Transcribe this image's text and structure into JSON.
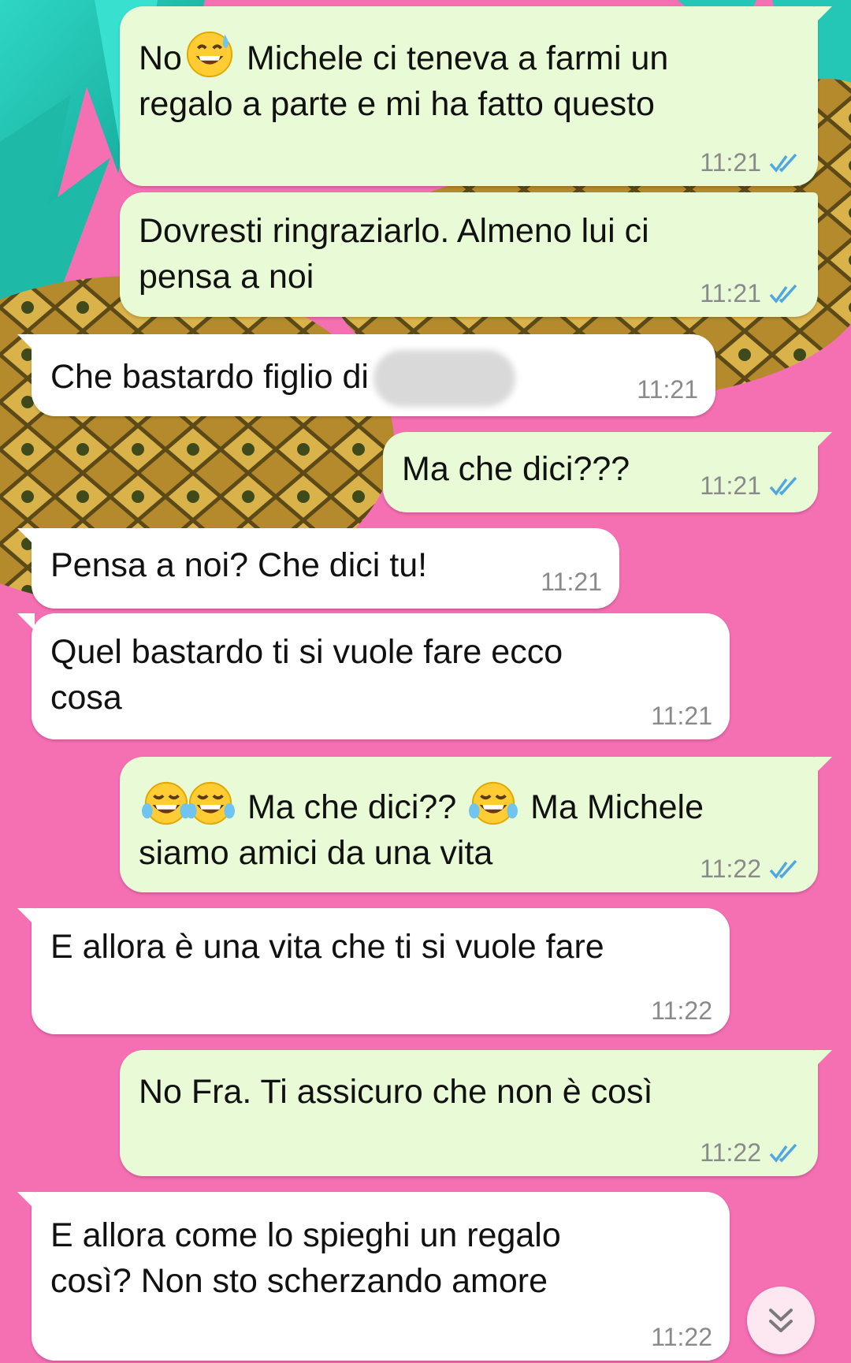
{
  "colors": {
    "outgoing_bubble": "#e8fbd6",
    "incoming_bubble": "#ffffff",
    "wallpaper_pink": "#f56fb3",
    "read_ticks": "#4fa7e0",
    "timestamp": "#8a8a8a"
  },
  "messages": [
    {
      "direction": "outgoing",
      "text_before_emoji": "No",
      "emoji": "grinning-sweat-emoji",
      "text": "Michele ci teneva a farmi un regalo a parte e mi ha fatto questo",
      "time": "11:21",
      "status": "read"
    },
    {
      "direction": "outgoing",
      "text": "Dovresti ringraziarlo. Almeno lui ci pensa a noi",
      "time": "11:21",
      "status": "read"
    },
    {
      "direction": "incoming",
      "text": "Che bastardo figlio di",
      "redacted": true,
      "time": "11:21"
    },
    {
      "direction": "outgoing",
      "text": "Ma che dici???",
      "time": "11:21",
      "status": "read"
    },
    {
      "direction": "incoming",
      "text": "Pensa a noi? Che dici tu!",
      "time": "11:21"
    },
    {
      "direction": "incoming",
      "text": "Quel bastardo ti si vuole fare ecco cosa",
      "time": "11:21"
    },
    {
      "direction": "outgoing",
      "text_a": "Ma che dici??",
      "text_b": "Ma Michele siamo amici da una vita",
      "emoji": "tears-of-joy-emoji",
      "time": "11:22",
      "status": "read"
    },
    {
      "direction": "incoming",
      "text": "E allora è una vita che ti si vuole fare",
      "time": "11:22"
    },
    {
      "direction": "outgoing",
      "text": "No Fra. Ti assicuro che non è così",
      "time": "11:22",
      "status": "read"
    },
    {
      "direction": "incoming",
      "text": "E allora come lo spieghi un regalo così? Non sto scherzando amore",
      "time": "11:22"
    }
  ],
  "scroll_button": {
    "icon": "double-chevron-down-icon"
  }
}
